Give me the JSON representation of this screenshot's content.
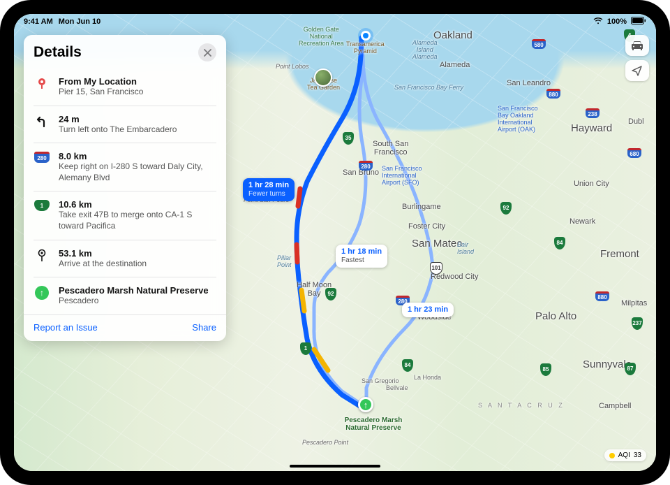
{
  "status": {
    "time": "9:41 AM",
    "date": "Mon Jun 10",
    "battery": "100%"
  },
  "panel": {
    "title": "Details",
    "steps": [
      {
        "icon": "pin-start",
        "line1": "From My Location",
        "line2": "Pier 15, San Francisco"
      },
      {
        "icon": "turn-left",
        "line1": "24 m",
        "line2": "Turn left onto The Embarcadero"
      },
      {
        "icon": "i280",
        "line1": "8.0 km",
        "line2": "Keep right on I-280 S toward Daly City, Alemany Blvd"
      },
      {
        "icon": "ca1",
        "line1": "10.6 km",
        "line2": "Take exit 47B to merge onto CA-1 S toward Pacifica"
      },
      {
        "icon": "arrive",
        "line1": "53.1 km",
        "line2": "Arrive at the destination"
      },
      {
        "icon": "dest",
        "line1": "Pescadero Marsh Natural Preserve",
        "line2": "Pescadero"
      }
    ],
    "report": "Report an Issue",
    "share": "Share"
  },
  "routes": {
    "primary": {
      "time": "1 hr 28 min",
      "sub": "Fewer turns"
    },
    "fastest": {
      "time": "1 hr 18 min",
      "sub": "Fastest"
    },
    "alternate": {
      "time": "1 hr 23 min",
      "sub": ""
    }
  },
  "destination_label": "Pescadero Marsh\nNatural Preserve",
  "aqi": {
    "label": "AQI",
    "value": "33"
  },
  "map_labels": {
    "oakland": "Oakland",
    "hayward": "Hayward",
    "sanmateo": "San Mateo",
    "paloalto": "Palo Alto",
    "fremont": "Fremont",
    "sunnyvale": "Sunnyvale",
    "southsf": "South San\nFrancisco",
    "sanbruno": "San Bruno",
    "burlingame": "Burlingame",
    "fostercity": "Foster City",
    "redwood": "Redwood City",
    "woodside": "Woodside",
    "halfmoon": "Half Moon\nBay",
    "unioncity": "Union City",
    "newark": "Newark",
    "alameda": "Alameda",
    "sanleandro": "San Leandro",
    "dublin": "Dubl",
    "milpitas": "Milpitas",
    "campbell": "Campbell",
    "sangregorio": "San Gregorio",
    "lahonda": "La Honda",
    "bellvale": "Bellvale",
    "pointlobos": "Point Lobos",
    "pointsanpedro": "Point San Pedro",
    "pescaderopoint": "Pescadero Point",
    "sfo": "San Francisco\nInternational\nAirport (SFO)",
    "oak": "San Francisco\nBay Oakland\nInternational\nAirport (OAK)",
    "bair": "Bair\nIsland",
    "alamedais": "Alameda\nIsland\nAlameda",
    "ggnra": "Golden Gate\nNational\nRecreation Area",
    "transamerica": "Transamerica\nPyramid",
    "teagarden": "Japanese\nTea Garden",
    "pillar": "Pillar\nPoint",
    "sfbayferry": "San Francisco Bay Ferry",
    "santacruz": "S A N T A   C R U Z"
  },
  "hwy": {
    "101": "101",
    "280": "280",
    "580": "580",
    "880": "880",
    "680": "680",
    "238": "238",
    "237": "237",
    "92": "92",
    "84": "84",
    "85": "85",
    "1": "1",
    "35": "35",
    "4": "4",
    "87": "87"
  }
}
